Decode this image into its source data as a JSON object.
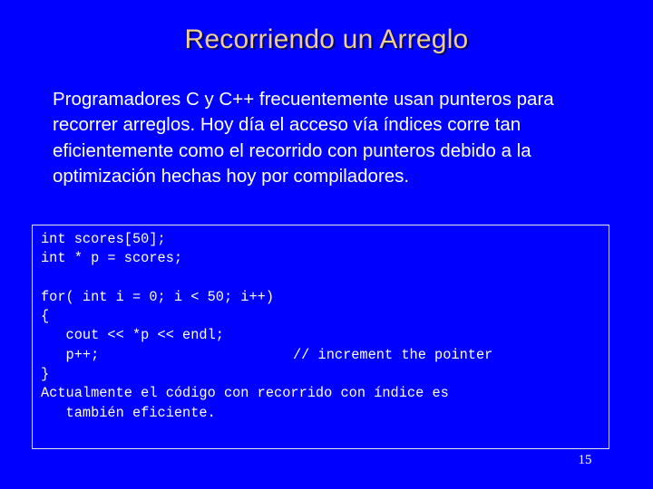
{
  "slide": {
    "background_color": "#0000FF",
    "title": "Recorriendo un Arreglo",
    "title_color": "#EFCE92",
    "body_color": "#FFFFFF",
    "body_text": "Programadores C y C++ frecuentemente usan punteros para recorrer arreglos. Hoy día el acceso vía índices corre tan eficientemente como el recorrido con punteros debido a la  optimización hechas hoy por compiladores.",
    "page_number": "15"
  },
  "code": {
    "border_color": "#E6E6E6",
    "text_color": "#FFFFFF",
    "lines": [
      {
        "text": "int scores[50];"
      },
      {
        "text": "int * p = scores;"
      },
      {
        "text": ""
      },
      {
        "text": "for( int i = 0; i < 50; i++)"
      },
      {
        "text": "{"
      },
      {
        "text": "   cout << *p << endl;"
      },
      {
        "text": "   p++;",
        "comment": "// increment the pointer"
      },
      {
        "text": "}"
      },
      {
        "text": "Actualmente el código con recorrido con índice es"
      },
      {
        "text": "   también eficiente."
      }
    ]
  }
}
